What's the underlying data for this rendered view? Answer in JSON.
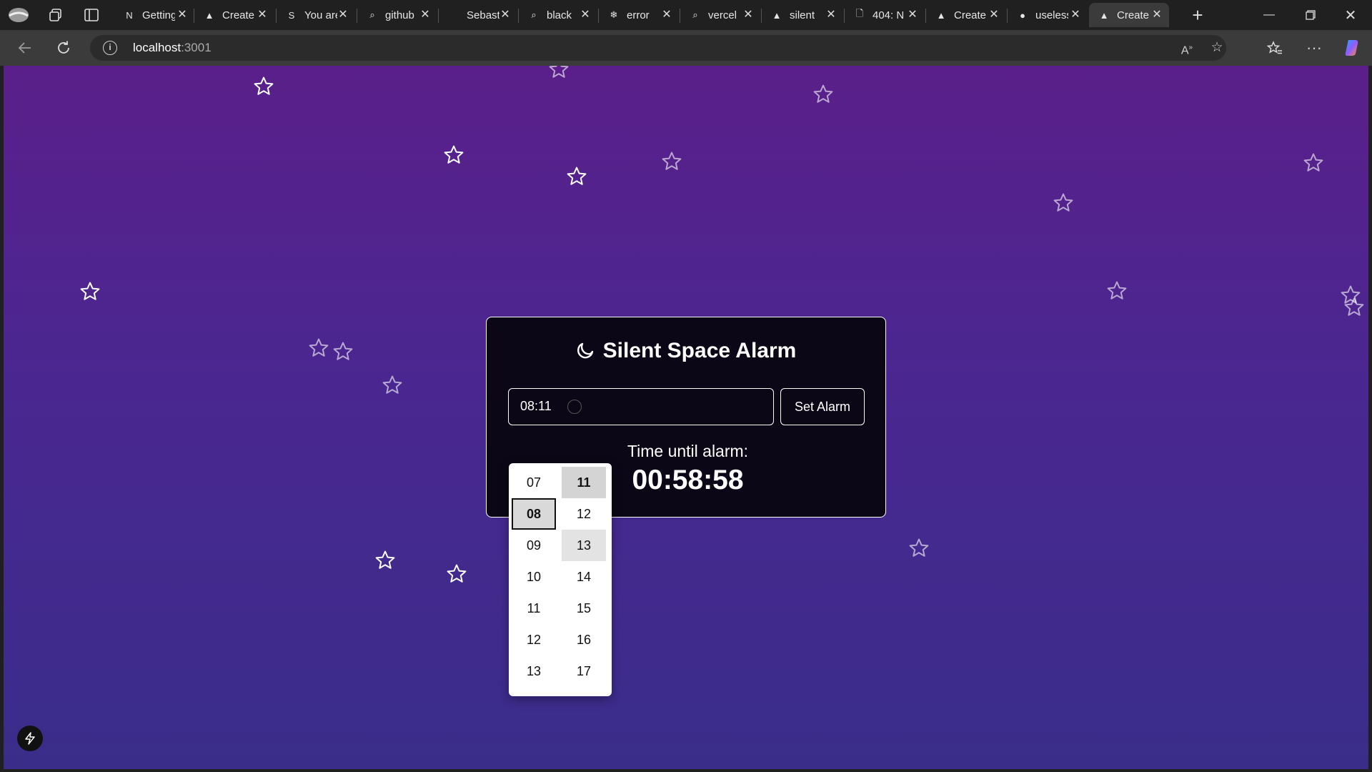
{
  "browser": {
    "tabs": [
      {
        "title": "Getting",
        "favicon": "N"
      },
      {
        "title": "Create",
        "favicon": "▲"
      },
      {
        "title": "You are",
        "favicon": "S"
      },
      {
        "title": "github",
        "favicon": "⌕"
      },
      {
        "title": "Sebastian",
        "favicon": ""
      },
      {
        "title": "black",
        "favicon": "⌕"
      },
      {
        "title": "error",
        "favicon": "❄"
      },
      {
        "title": "vercel",
        "favicon": "⌕"
      },
      {
        "title": "silent",
        "favicon": "▲"
      },
      {
        "title": "404: N",
        "favicon": "🗋"
      },
      {
        "title": "Create",
        "favicon": "▲"
      },
      {
        "title": "useless",
        "favicon": "●"
      },
      {
        "title": "Create",
        "favicon": "▲"
      }
    ],
    "address": {
      "host": "localhost",
      "port": ":3001"
    }
  },
  "app": {
    "title": "Silent Space Alarm",
    "time_value": "08:11",
    "set_alarm_label": "Set Alarm",
    "until_label": "Time until alarm:",
    "countdown": "00:58:58",
    "picker": {
      "hours": [
        "07",
        "08",
        "09",
        "10",
        "11",
        "12",
        "13"
      ],
      "minutes": [
        "11",
        "12",
        "13",
        "14",
        "15",
        "16",
        "17"
      ],
      "selected_hour": "08",
      "selected_minute": "11",
      "hovered_minute": "13"
    }
  },
  "colors": {
    "bg_top": "#5a1f8a",
    "bg_bottom": "#3a2d8a",
    "card_bg": "#0b0716",
    "star_stroke": "#ffffff"
  }
}
